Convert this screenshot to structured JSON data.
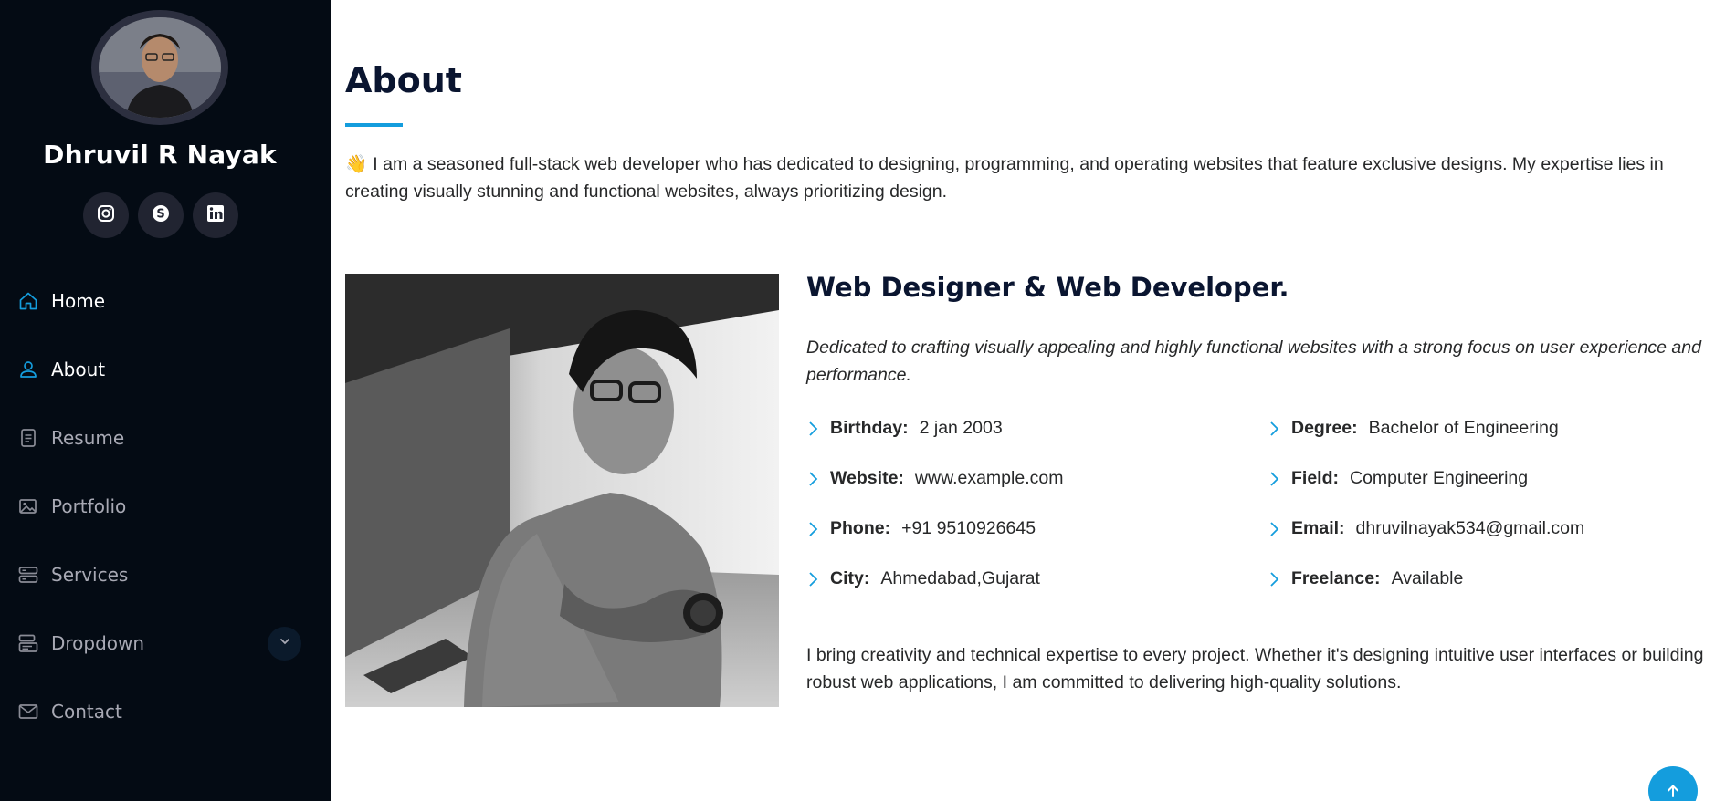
{
  "profile": {
    "name": "Dhruvil R Nayak",
    "social": [
      "instagram-icon",
      "skype-icon",
      "linkedin-icon"
    ]
  },
  "nav": {
    "items": [
      {
        "label": "Home",
        "icon": "house-icon"
      },
      {
        "label": "About",
        "icon": "person-icon"
      },
      {
        "label": "Resume",
        "icon": "file-text-icon"
      },
      {
        "label": "Portfolio",
        "icon": "images-icon"
      },
      {
        "label": "Services",
        "icon": "server-icon"
      },
      {
        "label": "Dropdown",
        "icon": "menu-button-icon"
      },
      {
        "label": "Contact",
        "icon": "envelope-icon"
      }
    ],
    "active": "About"
  },
  "about": {
    "title": "About",
    "intro_emoji": "👋",
    "intro": "I am a seasoned full-stack web developer who has dedicated to designing, programming, and operating websites that feature exclusive designs. My expertise lies in creating visually stunning and functional websites, always prioritizing design.",
    "role_title": "Web Designer & Web Developer.",
    "tagline": "Dedicated to crafting visually appealing and highly functional websites with a strong focus on user experience and performance.",
    "info_left": [
      {
        "key": "Birthday:",
        "value": "2 jan 2003"
      },
      {
        "key": "Website:",
        "value": "www.example.com"
      },
      {
        "key": "Phone:",
        "value": "+91 9510926645"
      },
      {
        "key": "City:",
        "value": "Ahmedabad,Gujarat"
      }
    ],
    "info_right": [
      {
        "key": "Degree:",
        "value": "Bachelor of Engineering"
      },
      {
        "key": "Field:",
        "value": "Computer Engineering"
      },
      {
        "key": "Email:",
        "value": "dhruvilnayak534@gmail.com"
      },
      {
        "key": "Freelance:",
        "value": "Available"
      }
    ],
    "closing": "I bring creativity and technical expertise to every project. Whether it's designing intuitive user interfaces or building robust web applications, I am committed to delivering high-quality solutions."
  },
  "colors": {
    "sidebar_bg": "#040b14",
    "accent": "#149ddd",
    "nav_text": "#a8a9b4",
    "heading": "#0a1530"
  }
}
